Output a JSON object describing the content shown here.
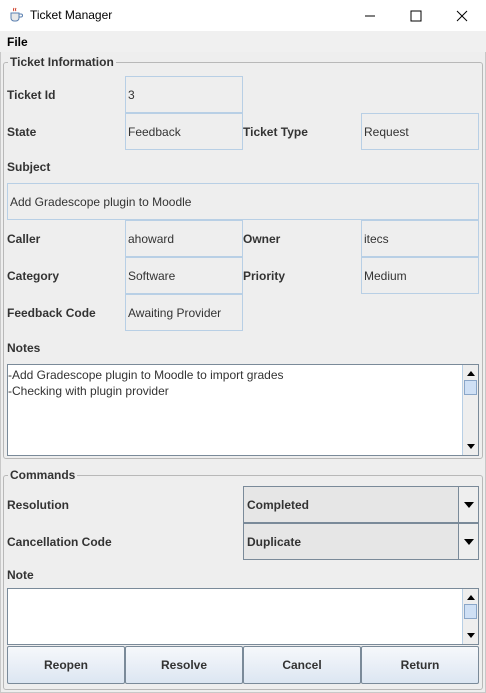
{
  "window": {
    "title": "Ticket Manager",
    "icon": "java-cup-icon",
    "controls": [
      "minimize-icon",
      "maximize-icon",
      "close-icon"
    ]
  },
  "menu": {
    "file": "File"
  },
  "ticket_info": {
    "legend": "Ticket Information",
    "ticket_id_label": "Ticket Id",
    "ticket_id": "3",
    "state_label": "State",
    "state": "Feedback",
    "ticket_type_label": "Ticket Type",
    "ticket_type": "Request",
    "subject_label": "Subject",
    "subject": "Add Gradescope plugin to Moodle",
    "caller_label": "Caller",
    "caller": "ahoward",
    "owner_label": "Owner",
    "owner": "itecs",
    "category_label": "Category",
    "category": "Software",
    "priority_label": "Priority",
    "priority": "Medium",
    "feedback_code_label": "Feedback Code",
    "feedback_code": "Awaiting Provider",
    "notes_label": "Notes",
    "notes_lines": [
      "-Add Gradescope plugin to Moodle to import grades",
      "-Checking with plugin provider"
    ]
  },
  "commands": {
    "legend": "Commands",
    "resolution_label": "Resolution",
    "resolution": "Completed",
    "cancellation_label": "Cancellation Code",
    "cancellation": "Duplicate",
    "note_label": "Note"
  },
  "buttons": {
    "reopen": "Reopen",
    "resolve": "Resolve",
    "cancel": "Cancel",
    "return": "Return"
  },
  "colors": {
    "field_border": "#b8cfe5",
    "textarea_bg": "#ffffff",
    "panel_bg": "#eeeeee"
  }
}
